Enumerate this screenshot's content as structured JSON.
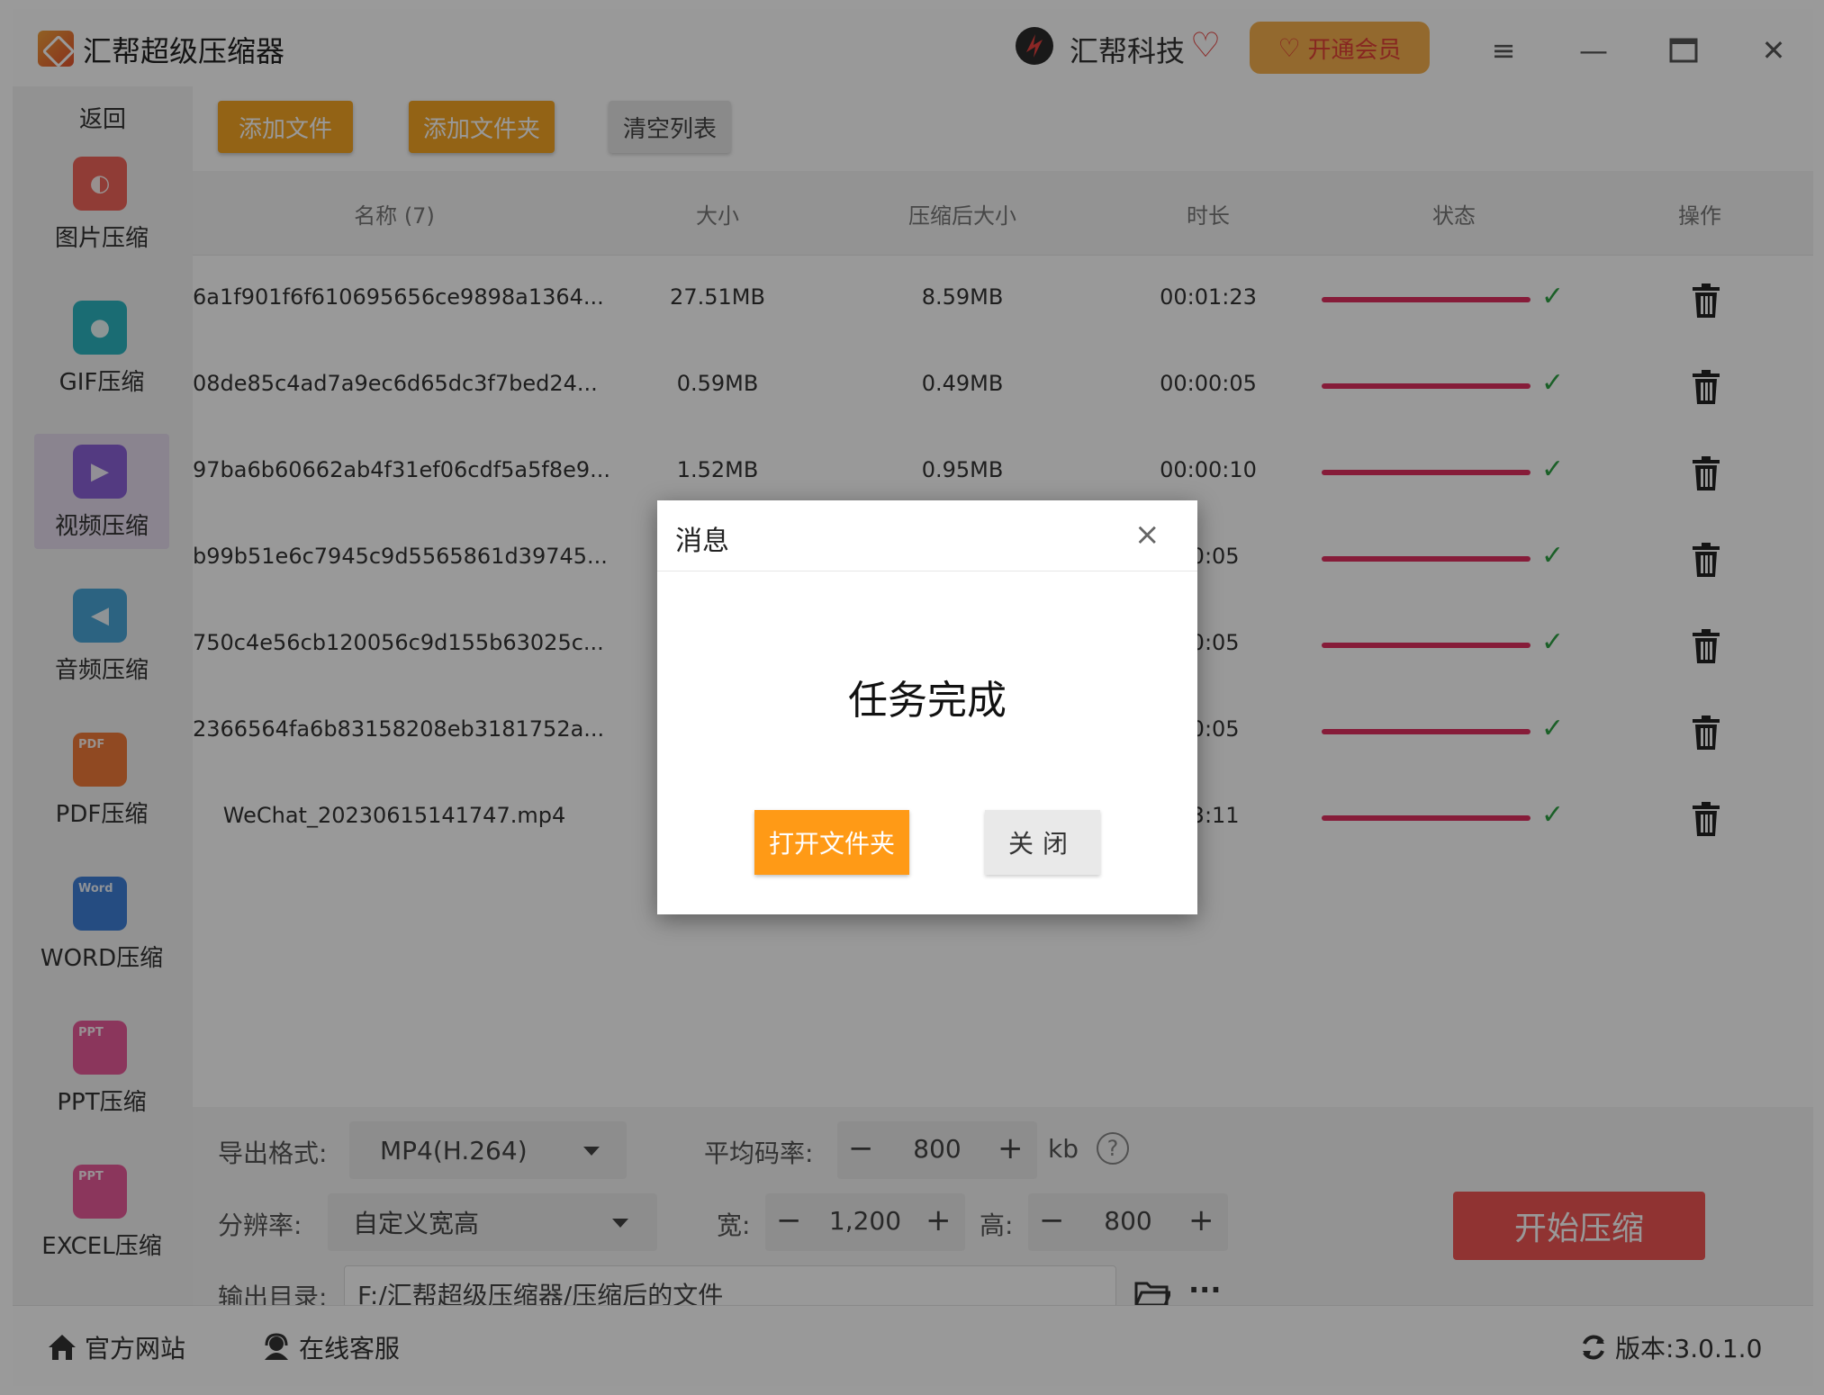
{
  "titlebar": {
    "title": "汇帮超级压缩器",
    "brand": "汇帮科技",
    "vip_label": "开通会员",
    "menu_icon": "menu-icon",
    "minimize_icon": "minimize-icon",
    "maximize_icon": "maximize-icon",
    "close_icon": "close-icon"
  },
  "sidebar": {
    "back": "返回",
    "items": [
      {
        "label": "图片压缩",
        "icon": "image-icon",
        "color": "#f0645a"
      },
      {
        "label": "GIF压缩",
        "icon": "gif-icon",
        "color": "#2cb5c0"
      },
      {
        "label": "视频压缩",
        "icon": "video-icon",
        "color": "#8a62d8"
      },
      {
        "label": "音频压缩",
        "icon": "audio-icon",
        "color": "#4aa6d8"
      },
      {
        "label": "PDF压缩",
        "icon": "pdf-icon",
        "color": "#f07a3a",
        "badge": "PDF"
      },
      {
        "label": "WORD压缩",
        "icon": "word-icon",
        "color": "#3f7fd8",
        "badge": "Word"
      },
      {
        "label": "PPT压缩",
        "icon": "ppt-icon",
        "color": "#e85a9a",
        "badge": "PPT"
      },
      {
        "label": "EXCEL压缩",
        "icon": "excel-icon",
        "color": "#e85a9a",
        "badge": "PPT"
      }
    ]
  },
  "toolbar": {
    "add_file": "添加文件",
    "add_folder": "添加文件夹",
    "clear_list": "清空列表"
  },
  "table": {
    "headers": {
      "name": "名称 (7)",
      "size": "大小",
      "compressed_size": "压缩后大小",
      "duration": "时长",
      "status": "状态",
      "action": "操作"
    },
    "rows": [
      {
        "name": "6a1f901f6f610695656ce9898a1364...",
        "size": "27.51MB",
        "compressed": "8.59MB",
        "duration": "00:01:23"
      },
      {
        "name": "08de85c4ad7a9ec6d65dc3f7bed24...",
        "size": "0.59MB",
        "compressed": "0.49MB",
        "duration": "00:00:05"
      },
      {
        "name": "97ba6b60662ab4f31ef06cdf5a5f8e9...",
        "size": "1.52MB",
        "compressed": "0.95MB",
        "duration": "00:00:10"
      },
      {
        "name": "b99b51e6c7945c9d5565861d39745...",
        "size": "",
        "compressed": "",
        "duration": "00:05"
      },
      {
        "name": "750c4e56cb120056c9d155b63025c...",
        "size": "",
        "compressed": "",
        "duration": "00:05"
      },
      {
        "name": "2366564fa6b83158208eb3181752a...",
        "size": "",
        "compressed": "",
        "duration": "00:05"
      },
      {
        "name": "WeChat_20230615141747.mp4",
        "size": "",
        "compressed": "",
        "duration": "03:11"
      }
    ],
    "progress_color": "#e0305f",
    "progress_fraction": 1.0
  },
  "settings": {
    "format_label": "导出格式:",
    "format_value": "MP4(H.264)",
    "bitrate_label": "平均码率:",
    "bitrate_value": "800",
    "bitrate_unit": "kb",
    "resolution_label": "分辨率:",
    "resolution_value": "自定义宽高",
    "width_label": "宽:",
    "width_value": "1,200",
    "height_label": "高:",
    "height_value": "800",
    "output_label": "输出目录:",
    "output_value": "F:/汇帮超级压缩器/压缩后的文件",
    "start_label": "开始压缩",
    "minus": "−",
    "plus": "+",
    "help": "?",
    "more": "···"
  },
  "statusbar": {
    "website": "官方网站",
    "support": "在线客服",
    "version": "版本:3.0.1.0"
  },
  "dialog": {
    "title": "消息",
    "message": "任务完成",
    "open_folder": "打开文件夹",
    "close": "关闭",
    "close_x": "×"
  }
}
